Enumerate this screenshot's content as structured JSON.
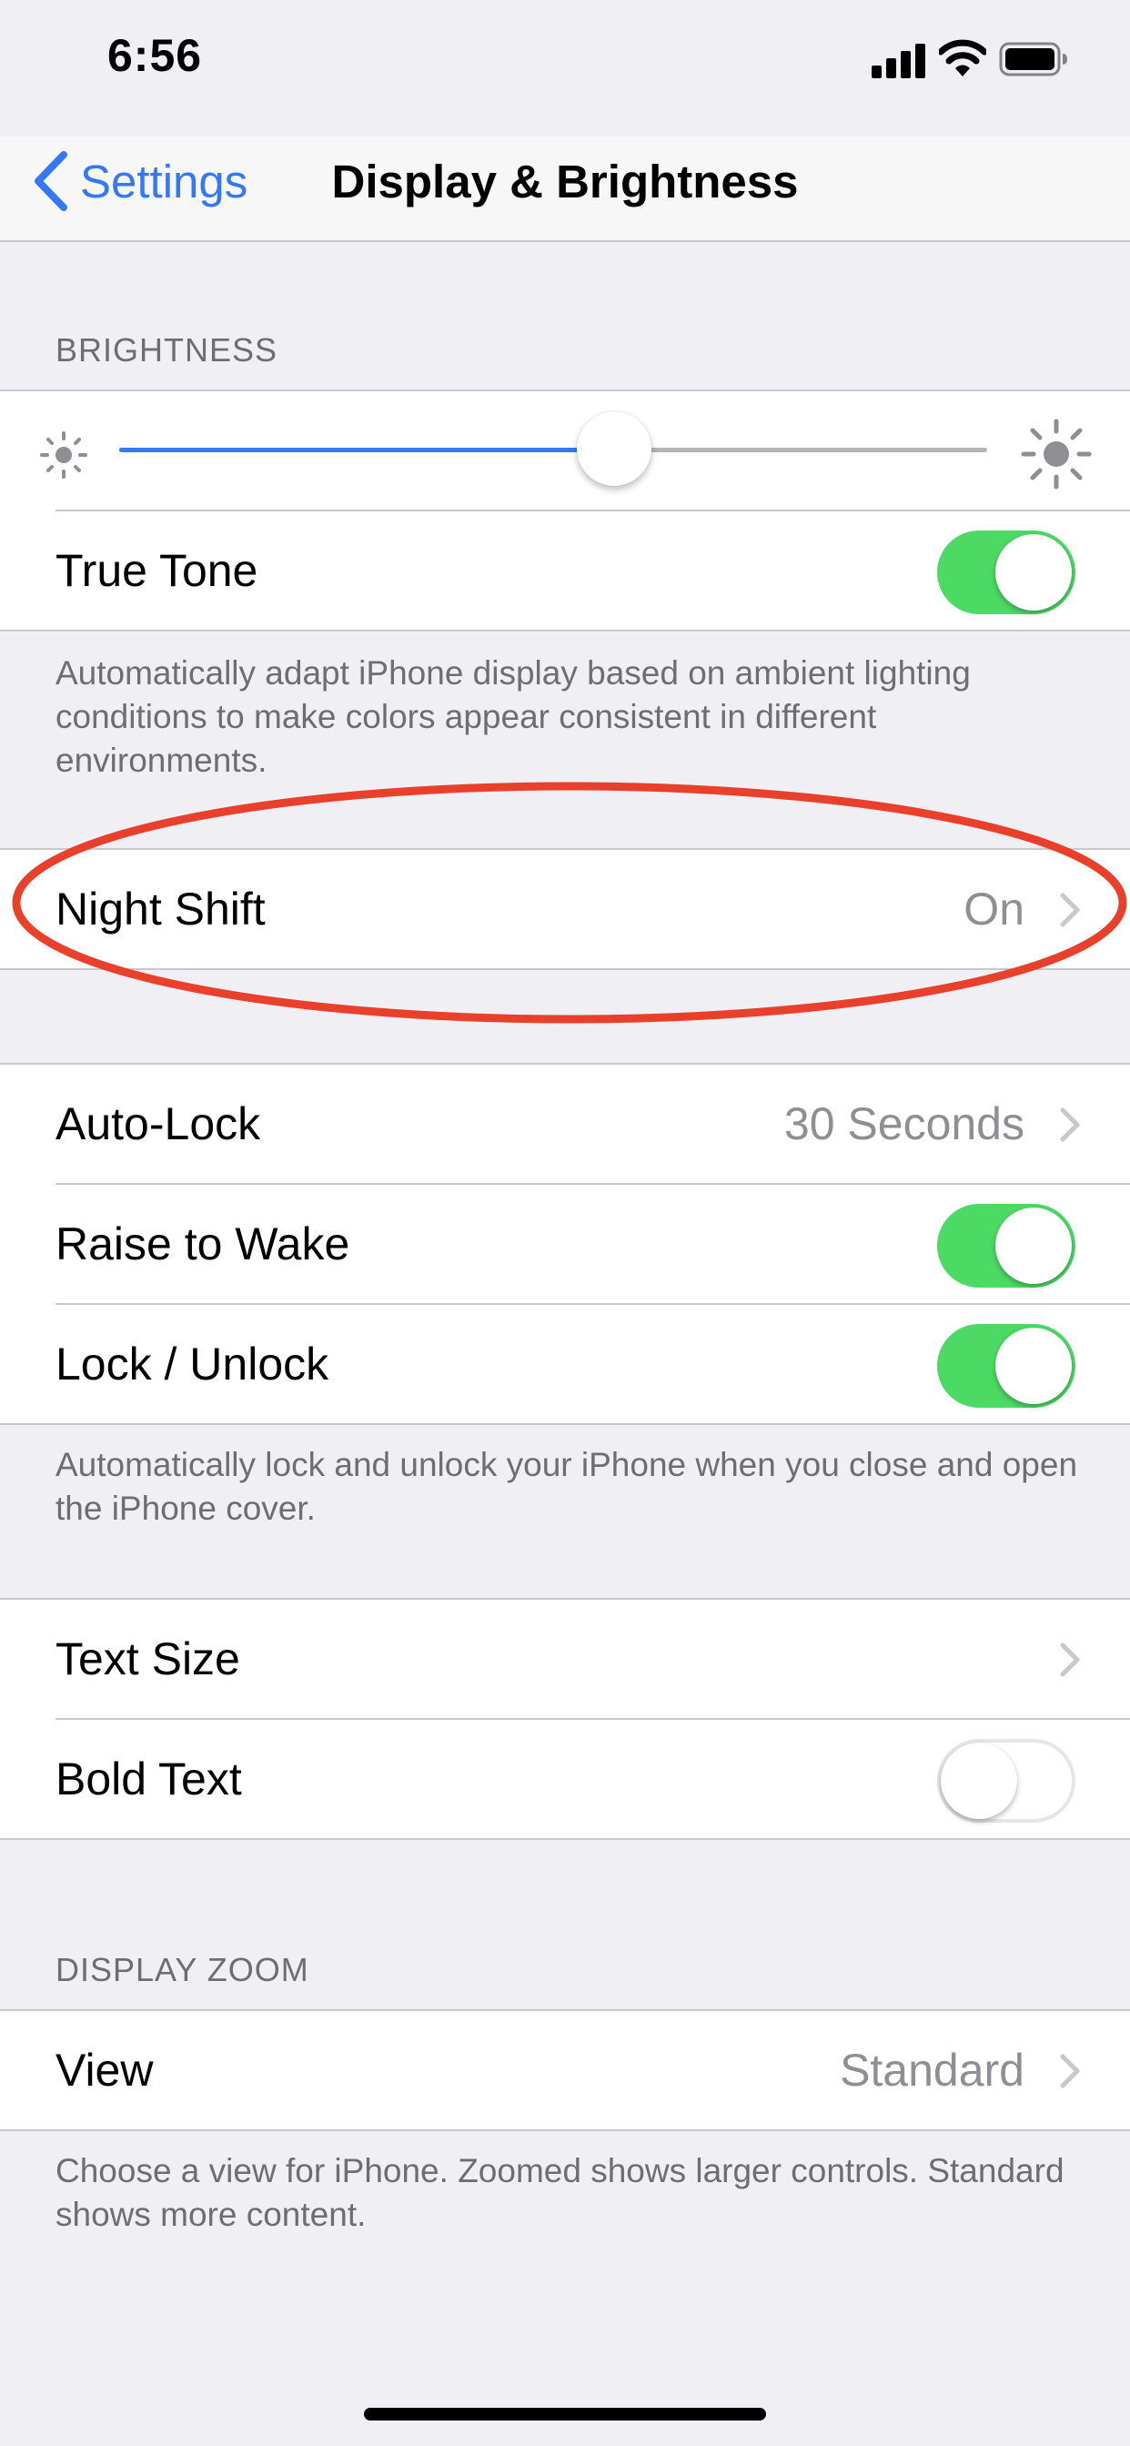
{
  "status_bar": {
    "time": "6:56",
    "icons": [
      "cellular-signal-icon",
      "wifi-icon",
      "battery-icon"
    ]
  },
  "nav": {
    "back_label": "Settings",
    "title": "Display & Brightness"
  },
  "colors": {
    "accent": "#3478f6",
    "toggle_on": "#4cd964",
    "annotation": "#e8402a",
    "background": "#efeff4"
  },
  "brightness": {
    "header": "BRIGHTNESS",
    "level": 0.57,
    "true_tone_label": "True Tone",
    "true_tone_on": true,
    "footer": "Automatically adapt iPhone display based on ambient lighting conditions to make colors appear consistent in different environments."
  },
  "night_shift": {
    "label": "Night Shift",
    "value": "On"
  },
  "lock": {
    "auto_lock_label": "Auto-Lock",
    "auto_lock_value": "30 Seconds",
    "raise_to_wake_label": "Raise to Wake",
    "raise_to_wake_on": true,
    "lock_unlock_label": "Lock / Unlock",
    "lock_unlock_on": true,
    "footer": "Automatically lock and unlock your iPhone when you close and open the iPhone cover."
  },
  "text": {
    "text_size_label": "Text Size",
    "bold_text_label": "Bold Text",
    "bold_text_on": false
  },
  "display_zoom": {
    "header": "DISPLAY ZOOM",
    "view_label": "View",
    "view_value": "Standard",
    "footer": "Choose a view for iPhone. Zoomed shows larger controls. Standard shows more content."
  }
}
